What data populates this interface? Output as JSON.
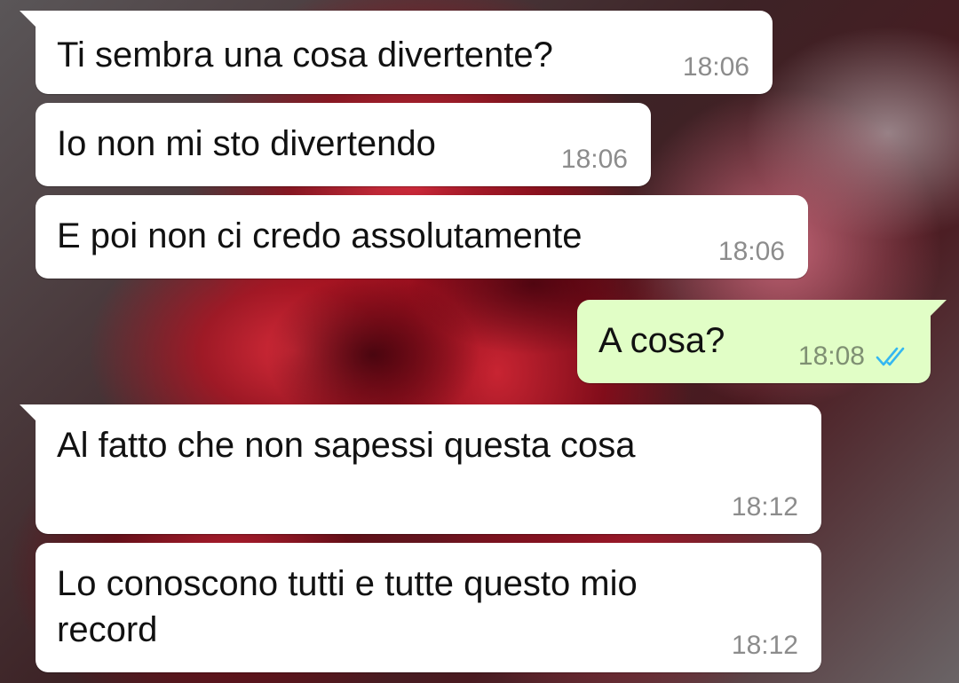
{
  "messages": [
    {
      "direction": "incoming",
      "text": "Ti sembra una cosa divertente?",
      "time": "18:06"
    },
    {
      "direction": "incoming",
      "text": "Io non mi sto divertendo",
      "time": "18:06"
    },
    {
      "direction": "incoming",
      "text": "E poi non ci credo assolutamente",
      "time": "18:06"
    },
    {
      "direction": "outgoing",
      "text": "A cosa?",
      "time": "18:08",
      "status_icon": "double-check-read-icon",
      "status_color": "#34b7f1"
    },
    {
      "direction": "incoming",
      "text": "Al fatto che non sapessi questa cosa",
      "time": "18:12"
    },
    {
      "direction": "incoming",
      "text": "Lo conoscono tutti e tutte questo mio\nrecord",
      "time": "18:12"
    }
  ],
  "colors": {
    "incoming_bubble": "#ffffff",
    "outgoing_bubble": "#e1fec6",
    "read_ticks": "#34b7f1",
    "wallpaper": "#c82432"
  }
}
